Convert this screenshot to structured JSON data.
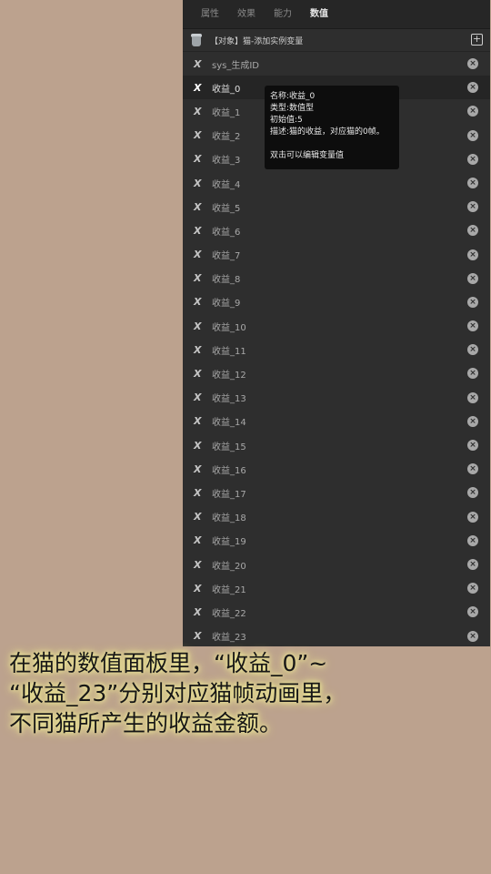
{
  "tabs": [
    {
      "label": "属性"
    },
    {
      "label": "效果"
    },
    {
      "label": "能力"
    },
    {
      "label": "数值"
    }
  ],
  "active_tab": "数值",
  "object": {
    "text": "【对象】猫-添加实例变量",
    "add_symbol": "+"
  },
  "variables": [
    {
      "name": "sys_生成ID"
    },
    {
      "name": "收益_0"
    },
    {
      "name": "收益_1"
    },
    {
      "name": "收益_2"
    },
    {
      "name": "收益_3"
    },
    {
      "name": "收益_4"
    },
    {
      "name": "收益_5"
    },
    {
      "name": "收益_6"
    },
    {
      "name": "收益_7"
    },
    {
      "name": "收益_8"
    },
    {
      "name": "收益_9"
    },
    {
      "name": "收益_10"
    },
    {
      "name": "收益_11"
    },
    {
      "name": "收益_12"
    },
    {
      "name": "收益_13"
    },
    {
      "name": "收益_14"
    },
    {
      "name": "收益_15"
    },
    {
      "name": "收益_16"
    },
    {
      "name": "收益_17"
    },
    {
      "name": "收益_18"
    },
    {
      "name": "收益_19"
    },
    {
      "name": "收益_20"
    },
    {
      "name": "收益_21"
    },
    {
      "name": "收益_22"
    },
    {
      "name": "收益_23"
    }
  ],
  "selected_variable": "收益_0",
  "tooltip": {
    "name_line": "名称:收益_0",
    "type_line": "类型:数值型",
    "initial_line": "初始值:5",
    "desc_line": "描述:猫的收益，对应猫的0帧。",
    "hint_line": "双击可以编辑变量值"
  },
  "caption": {
    "line1": "在猫的数值面板里，“收益_0”~",
    "line2": "“收益_23”分别对应猫帧动画里，",
    "line3": "不同猫所产生的收益金额。"
  },
  "colors": {
    "background": "#bca28e",
    "panel": "#2e2e2e",
    "caption_glow": "#f0ec9a"
  }
}
